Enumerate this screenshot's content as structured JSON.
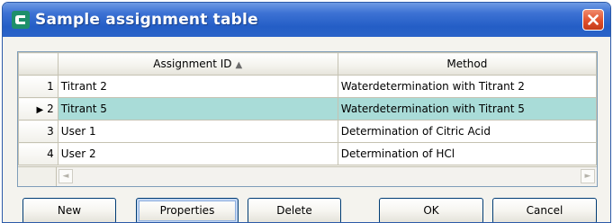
{
  "window": {
    "title": "Sample assignment table",
    "icon": "app-icon",
    "title_color": "#2563c9",
    "close_icon": "close-icon"
  },
  "table": {
    "columns": [
      "Assignment ID",
      "Method"
    ],
    "sort_column": "Assignment ID",
    "sort_direction": "ascending",
    "sort_indicator": "▲",
    "selected_row": 2,
    "selection_color": "#a9dcd8",
    "rows": [
      {
        "index": "1",
        "marker": "",
        "assignment_id": "Titrant 2",
        "method": "Waterdetermination with Titrant 2"
      },
      {
        "index": "2",
        "marker": "▶",
        "assignment_id": "Titrant 5",
        "method": "Waterdetermination with Titrant 5"
      },
      {
        "index": "3",
        "marker": "",
        "assignment_id": "User 1",
        "method": "Determination of Citric Acid"
      },
      {
        "index": "4",
        "marker": "",
        "assignment_id": "User 2",
        "method": "Determination of HCl"
      }
    ],
    "scroll_left_glyph": "◄",
    "scroll_right_glyph": "►"
  },
  "buttons": {
    "new": "New",
    "properties": "Properties",
    "delete": "Delete",
    "ok": "OK",
    "cancel": "Cancel"
  }
}
